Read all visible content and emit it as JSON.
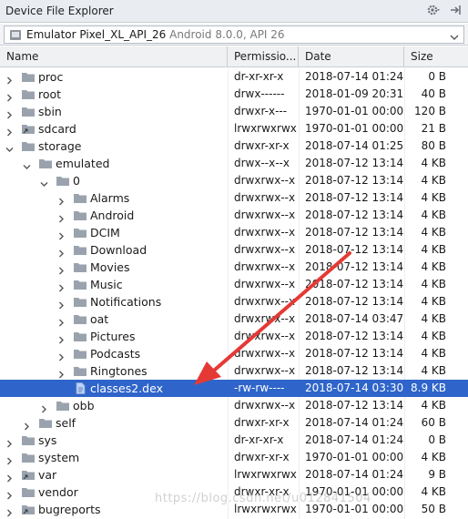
{
  "window": {
    "title": "Device File Explorer"
  },
  "device": {
    "name": "Emulator Pixel_XL_API_26",
    "subtitle": "Android 8.0.0, API 26"
  },
  "columns": {
    "name": "Name",
    "permissions": "Permissio...",
    "date": "Date",
    "size": "Size"
  },
  "rows": [
    {
      "name": "proc",
      "perms": "dr-xr-xr-x",
      "date": "2018-07-14 01:24",
      "size": "0 B"
    },
    {
      "name": "root",
      "perms": "drwx------",
      "date": "2018-01-09 20:31",
      "size": "40 B"
    },
    {
      "name": "sbin",
      "perms": "drwxr-x---",
      "date": "1970-01-01 00:00",
      "size": "120 B"
    },
    {
      "name": "sdcard",
      "perms": "lrwxrwxrwx",
      "date": "1970-01-01 00:00",
      "size": "21 B"
    },
    {
      "name": "storage",
      "perms": "drwxr-xr-x",
      "date": "2018-07-14 01:25",
      "size": "80 B"
    },
    {
      "name": "emulated",
      "perms": "drwx--x--x",
      "date": "2018-07-12 13:14",
      "size": "4 KB"
    },
    {
      "name": "0",
      "perms": "drwxrwx--x",
      "date": "2018-07-12 13:14",
      "size": "4 KB"
    },
    {
      "name": "Alarms",
      "perms": "drwxrwx--x",
      "date": "2018-07-12 13:14",
      "size": "4 KB"
    },
    {
      "name": "Android",
      "perms": "drwxrwx--x",
      "date": "2018-07-12 13:14",
      "size": "4 KB"
    },
    {
      "name": "DCIM",
      "perms": "drwxrwx--x",
      "date": "2018-07-12 13:14",
      "size": "4 KB"
    },
    {
      "name": "Download",
      "perms": "drwxrwx--x",
      "date": "2018-07-12 13:14",
      "size": "4 KB"
    },
    {
      "name": "Movies",
      "perms": "drwxrwx--x",
      "date": "2018-07-12 13:14",
      "size": "4 KB"
    },
    {
      "name": "Music",
      "perms": "drwxrwx--x",
      "date": "2018-07-12 13:14",
      "size": "4 KB"
    },
    {
      "name": "Notifications",
      "perms": "drwxrwx--x",
      "date": "2018-07-12 13:14",
      "size": "4 KB"
    },
    {
      "name": "oat",
      "perms": "drwxrwx--x",
      "date": "2018-07-14 03:47",
      "size": "4 KB"
    },
    {
      "name": "Pictures",
      "perms": "drwxrwx--x",
      "date": "2018-07-12 13:14",
      "size": "4 KB"
    },
    {
      "name": "Podcasts",
      "perms": "drwxrwx--x",
      "date": "2018-07-12 13:14",
      "size": "4 KB"
    },
    {
      "name": "Ringtones",
      "perms": "drwxrwx--x",
      "date": "2018-07-12 13:14",
      "size": "4 KB"
    },
    {
      "name": "classes2.dex",
      "perms": "-rw-rw----",
      "date": "2018-07-14 03:30",
      "size": "8.9 KB"
    },
    {
      "name": "obb",
      "perms": "drwxrwx--x",
      "date": "2018-07-12 13:14",
      "size": "4 KB"
    },
    {
      "name": "self",
      "perms": "drwxr-xr-x",
      "date": "2018-07-14 01:24",
      "size": "60 B"
    },
    {
      "name": "sys",
      "perms": "dr-xr-xr-x",
      "date": "2018-07-14 01:24",
      "size": "0 B"
    },
    {
      "name": "system",
      "perms": "drwxr-xr-x",
      "date": "1970-01-01 00:00",
      "size": "4 KB"
    },
    {
      "name": "var",
      "perms": "lrwxrwxrwx",
      "date": "2018-07-14 01:24",
      "size": "9 B"
    },
    {
      "name": "vendor",
      "perms": "drwxr-xr-x",
      "date": "1970-01-01 00:00",
      "size": "4 KB"
    },
    {
      "name": "bugreports",
      "perms": "lrwxrwxrwx",
      "date": "1970-01-01 00:00",
      "size": "50 B"
    }
  ],
  "colors": {
    "selection": "#2f65ca",
    "folder": "#9aa3ad",
    "annotation_arrow": "#e53935"
  },
  "watermark": "https://blog.csdn.net/u012841504"
}
